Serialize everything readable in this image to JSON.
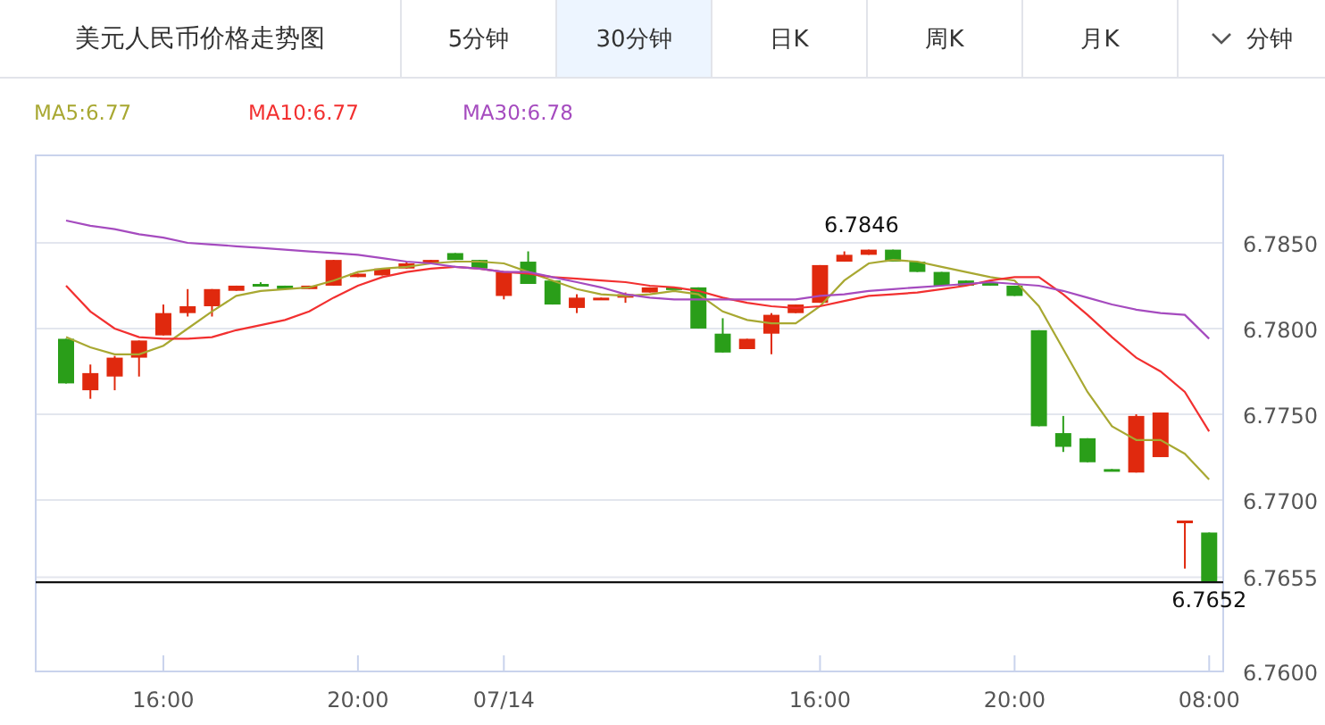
{
  "header": {
    "title": "美元人民币价格走势图",
    "tabs": [
      {
        "label": "5分钟",
        "selected": false
      },
      {
        "label": "30分钟",
        "selected": true
      },
      {
        "label": "日K",
        "selected": false
      },
      {
        "label": "周K",
        "selected": false
      },
      {
        "label": "月K",
        "selected": false
      }
    ],
    "dropdown": {
      "label": "分钟"
    }
  },
  "chart": {
    "chart_data": {
      "type": "candlestick",
      "grid": true,
      "ylim": [
        6.76,
        6.7901
      ],
      "yticks": [
        {
          "value": 6.76,
          "label": "6.7600"
        },
        {
          "value": 6.7655,
          "label": "6.7655"
        },
        {
          "value": 6.77,
          "label": "6.7700"
        },
        {
          "value": 6.775,
          "label": "6.7750"
        },
        {
          "value": 6.78,
          "label": "6.7800"
        },
        {
          "value": 6.785,
          "label": "6.7850"
        }
      ],
      "categories": [
        null,
        null,
        null,
        null,
        "16:00",
        null,
        null,
        null,
        null,
        null,
        null,
        null,
        "20:00",
        null,
        null,
        null,
        null,
        null,
        "07/14",
        null,
        null,
        null,
        null,
        null,
        null,
        null,
        null,
        null,
        null,
        null,
        null,
        "16:00",
        null,
        null,
        null,
        null,
        null,
        null,
        null,
        "20:00",
        null,
        null,
        null,
        null,
        null,
        null,
        null,
        "08:00"
      ],
      "ohlc": [
        [
          6.7794,
          6.7794,
          6.7768,
          6.7768
        ],
        [
          6.7764,
          6.7779,
          6.7759,
          6.7774
        ],
        [
          6.7772,
          6.7784,
          6.7764,
          6.7783
        ],
        [
          6.7783,
          6.7793,
          6.7772,
          6.7793
        ],
        [
          6.7796,
          6.7814,
          6.7796,
          6.7809
        ],
        [
          6.7809,
          6.7823,
          6.7807,
          6.7813
        ],
        [
          6.7813,
          6.7823,
          6.7807,
          6.7823
        ],
        [
          6.7822,
          6.7825,
          6.7822,
          6.7825
        ],
        [
          6.7826,
          6.7827,
          6.7825,
          6.7825
        ],
        [
          6.7825,
          6.7825,
          6.7823,
          6.7823
        ],
        [
          6.7823,
          6.7825,
          6.7823,
          6.7825
        ],
        [
          6.7825,
          6.784,
          6.7825,
          6.784
        ],
        [
          6.783,
          6.7832,
          6.783,
          6.7832
        ],
        [
          6.7831,
          6.7835,
          6.7831,
          6.7835
        ],
        [
          6.7835,
          6.7839,
          6.7835,
          6.7838
        ],
        [
          6.7838,
          6.784,
          6.7838,
          6.784
        ],
        [
          6.7844,
          6.7844,
          6.784,
          6.784
        ],
        [
          6.784,
          6.784,
          6.7835,
          6.7835
        ],
        [
          6.7819,
          6.7833,
          6.7817,
          6.7833
        ],
        [
          6.7839,
          6.7845,
          6.7826,
          6.7826
        ],
        [
          6.7828,
          6.7828,
          6.7814,
          6.7814
        ],
        [
          6.7812,
          6.782,
          6.7809,
          6.7818
        ],
        [
          6.7817,
          6.7818,
          6.7817,
          6.7818
        ],
        [
          6.7818,
          6.7821,
          6.7815,
          6.782
        ],
        [
          6.7821,
          6.7824,
          6.7821,
          6.7824
        ],
        [
          6.7824,
          6.7824,
          6.7823,
          6.7823
        ],
        [
          6.7824,
          6.7824,
          6.78,
          6.78
        ],
        [
          6.7797,
          6.7806,
          6.7786,
          6.7786
        ],
        [
          6.7788,
          6.7794,
          6.7788,
          6.7794
        ],
        [
          6.7797,
          6.7809,
          6.7785,
          6.7808
        ],
        [
          6.7809,
          6.7814,
          6.7809,
          6.7814
        ],
        [
          6.7815,
          6.7837,
          6.7815,
          6.7837
        ],
        [
          6.7839,
          6.7845,
          6.7839,
          6.7843
        ],
        [
          6.7843,
          6.7846,
          6.7843,
          6.7846
        ],
        [
          6.7846,
          6.7846,
          6.7839,
          6.7839
        ],
        [
          6.7839,
          6.7839,
          6.7833,
          6.7833
        ],
        [
          6.7833,
          6.7833,
          6.7825,
          6.7825
        ],
        [
          6.7828,
          6.7828,
          6.7825,
          6.7825
        ],
        [
          6.7827,
          6.7827,
          6.7825,
          6.7825
        ],
        [
          6.7825,
          6.7825,
          6.7819,
          6.7819
        ],
        [
          6.7799,
          6.7799,
          6.7743,
          6.7743
        ],
        [
          6.7739,
          6.7749,
          6.7728,
          6.7731
        ],
        [
          6.7736,
          6.7736,
          6.7722,
          6.7722
        ],
        [
          6.7718,
          6.7718,
          6.7717,
          6.7717
        ],
        [
          6.7716,
          6.775,
          6.7716,
          6.7749
        ],
        [
          6.7725,
          6.7751,
          6.7725,
          6.7751
        ],
        [
          6.7687,
          6.7688,
          6.766,
          6.7688
        ],
        [
          6.7681,
          6.7681,
          6.7652,
          6.7652
        ]
      ],
      "annotations": [
        {
          "text": "6.7846",
          "y": 6.7846
        }
      ],
      "ref_lines": [
        {
          "axis": "y",
          "value": 6.7652,
          "label": "6.7652"
        }
      ],
      "series": [
        {
          "name": "MA5:6.77",
          "type": "line",
          "color": "#a8a832",
          "values": [
            6.7795,
            6.7789,
            6.7785,
            6.7785,
            6.779,
            6.78,
            6.781,
            6.7819,
            6.7822,
            6.7823,
            6.7824,
            6.7828,
            6.7833,
            6.7835,
            6.7836,
            6.7838,
            6.7839,
            6.7839,
            6.7838,
            6.7833,
            6.7828,
            6.7823,
            6.782,
            6.7819,
            6.782,
            6.7822,
            6.782,
            6.781,
            6.7805,
            6.7803,
            6.7803,
            6.7813,
            6.7828,
            6.7838,
            6.784,
            6.7839,
            6.7836,
            6.7833,
            6.783,
            6.7828,
            6.7813,
            6.7788,
            6.7763,
            6.7743,
            6.7735,
            6.7735,
            6.7727,
            6.7712
          ]
        },
        {
          "name": "MA10:6.77",
          "type": "line",
          "color": "#f23030",
          "values": [
            6.7825,
            6.781,
            6.78,
            6.7795,
            6.7794,
            6.7794,
            6.7795,
            6.7799,
            6.7802,
            6.7805,
            6.781,
            6.7818,
            6.7825,
            6.783,
            6.7833,
            6.7835,
            6.7836,
            6.7835,
            6.7833,
            6.7832,
            6.783,
            6.7829,
            6.7828,
            6.7827,
            6.7825,
            6.7824,
            6.7822,
            6.7818,
            6.7815,
            6.7813,
            6.7812,
            6.7813,
            6.7816,
            6.7819,
            6.782,
            6.7821,
            6.7823,
            6.7825,
            6.7828,
            6.783,
            6.783,
            6.782,
            6.7808,
            6.7795,
            6.7783,
            6.7775,
            6.7763,
            6.774
          ]
        },
        {
          "name": "MA30:6.78",
          "type": "line",
          "color": "#a54bbf",
          "values": [
            6.7863,
            6.786,
            6.7858,
            6.7855,
            6.7853,
            6.785,
            6.7849,
            6.7848,
            6.7847,
            6.7846,
            6.7845,
            6.7844,
            6.7843,
            6.7841,
            6.7839,
            6.7838,
            6.7836,
            6.7835,
            6.7833,
            6.7833,
            6.783,
            6.7827,
            6.7824,
            6.782,
            6.7818,
            6.7817,
            6.7817,
            6.7817,
            6.7817,
            6.7817,
            6.7817,
            6.7819,
            6.782,
            6.7822,
            6.7823,
            6.7824,
            6.7825,
            6.7826,
            6.7827,
            6.7826,
            6.7825,
            6.7822,
            6.7818,
            6.7814,
            6.7811,
            6.7809,
            6.7808,
            6.7794
          ]
        }
      ]
    }
  }
}
